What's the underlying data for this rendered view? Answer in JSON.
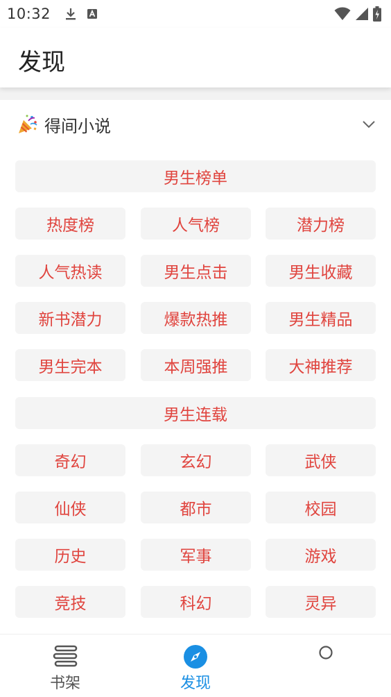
{
  "status_bar": {
    "time": "10:32"
  },
  "header": {
    "title": "发现"
  },
  "source": {
    "name": "得间小说",
    "emoji": "🎉"
  },
  "sections": [
    {
      "title": "男生榜单",
      "items": [
        "热度榜",
        "人气榜",
        "潜力榜",
        "人气热读",
        "男生点击",
        "男生收藏",
        "新书潜力",
        "爆款热推",
        "男生精品",
        "男生完本",
        "本周强推",
        "大神推荐"
      ]
    },
    {
      "title": "男生连载",
      "items": [
        "奇幻",
        "玄幻",
        "武侠",
        "仙侠",
        "都市",
        "校园",
        "历史",
        "军事",
        "游戏",
        "竞技",
        "科幻",
        "灵异"
      ]
    }
  ],
  "bottom_nav": {
    "items": [
      {
        "label": "书架",
        "icon": "bookshelf-icon",
        "active": false
      },
      {
        "label": "发现",
        "icon": "compass-icon",
        "active": true
      },
      {
        "label": "",
        "icon": "circle-icon",
        "active": false
      }
    ]
  },
  "colors": {
    "accent_red": "#e0443e",
    "nav_active": "#1a8fe3",
    "button_bg": "#f4f4f4"
  }
}
